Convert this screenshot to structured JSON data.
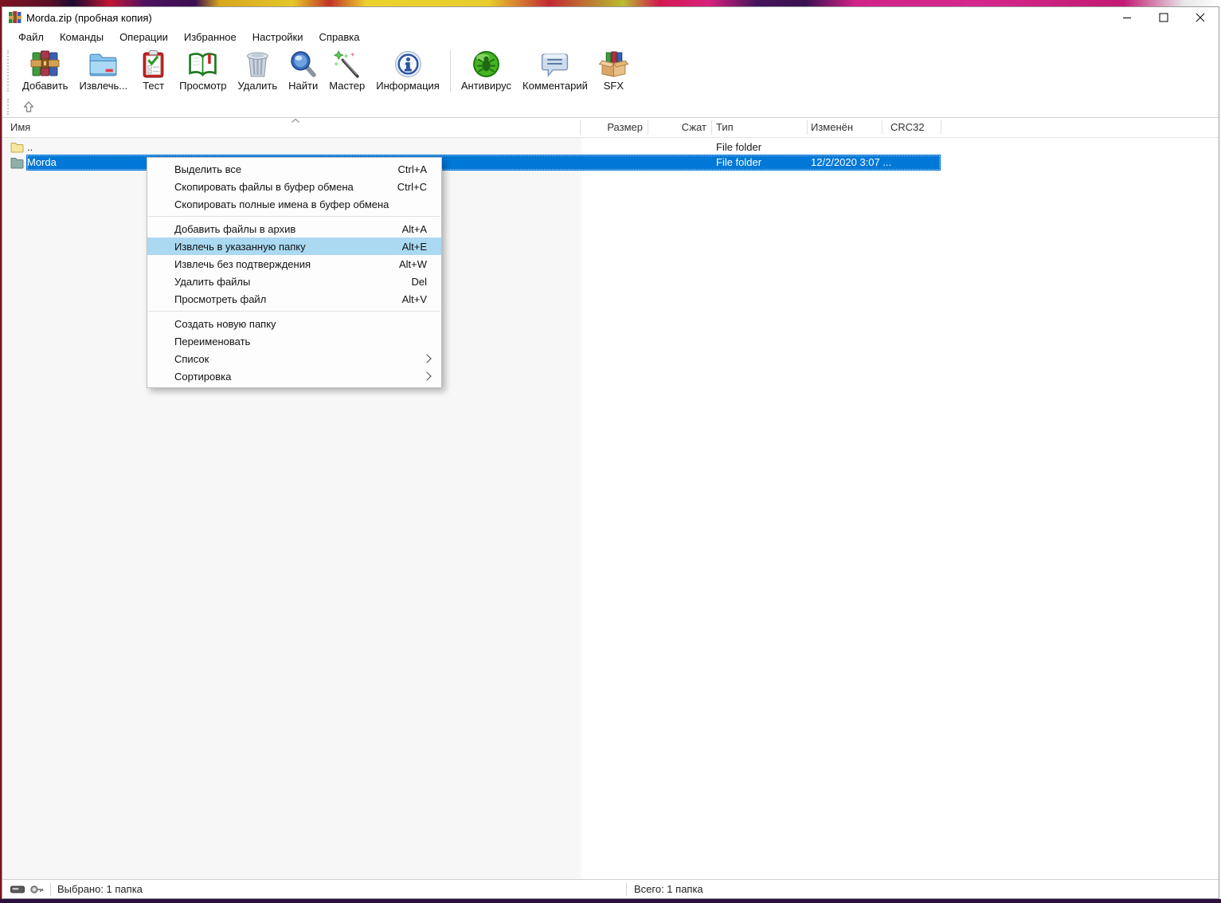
{
  "window": {
    "title": "Morda.zip (пробная копия)"
  },
  "menubar": {
    "items": [
      "Файл",
      "Команды",
      "Операции",
      "Избранное",
      "Настройки",
      "Справка"
    ]
  },
  "toolbar": {
    "buttons": [
      {
        "icon": "add-archive-icon",
        "label": "Добавить"
      },
      {
        "icon": "extract-folder-icon",
        "label": "Извлечь..."
      },
      {
        "icon": "test-clipboard-icon",
        "label": "Тест"
      },
      {
        "icon": "view-book-icon",
        "label": "Просмотр"
      },
      {
        "icon": "delete-trash-icon",
        "label": "Удалить"
      },
      {
        "icon": "find-magnifier-icon",
        "label": "Найти"
      },
      {
        "icon": "wizard-wand-icon",
        "label": "Мастер"
      },
      {
        "icon": "info-icon",
        "label": "Информация"
      },
      {
        "icon": "antivirus-bug-icon",
        "label": "Антивирус"
      },
      {
        "icon": "comment-bubble-icon",
        "label": "Комментарий"
      },
      {
        "icon": "sfx-box-icon",
        "label": "SFX"
      }
    ]
  },
  "columns": {
    "name": "Имя",
    "size": "Размер",
    "packed": "Сжат",
    "type": "Тип",
    "modified": "Изменён",
    "crc": "CRC32"
  },
  "rows": [
    {
      "name": "..",
      "type": "File folder",
      "modified": ""
    },
    {
      "name": "Morda",
      "type": "File folder",
      "modified": "12/2/2020 3:07 ...",
      "selected": true
    }
  ],
  "context_menu": {
    "items": [
      {
        "label": "Выделить все",
        "shortcut": "Ctrl+A"
      },
      {
        "label": "Скопировать файлы в буфер обмена",
        "shortcut": "Ctrl+C"
      },
      {
        "label": "Скопировать полные имена в буфер обмена",
        "shortcut": ""
      },
      {
        "label": "Добавить файлы в архив",
        "shortcut": "Alt+A"
      },
      {
        "label": "Извлечь в указанную папку",
        "shortcut": "Alt+E"
      },
      {
        "label": "Извлечь без подтверждения",
        "shortcut": "Alt+W"
      },
      {
        "label": "Удалить файлы",
        "shortcut": "Del"
      },
      {
        "label": "Просмотреть файл",
        "shortcut": "Alt+V"
      },
      {
        "label": "Создать новую папку",
        "shortcut": ""
      },
      {
        "label": "Переименовать",
        "shortcut": ""
      },
      {
        "label": "Список",
        "shortcut": ""
      },
      {
        "label": "Сортировка",
        "shortcut": ""
      }
    ],
    "highlighted_index": 4
  },
  "statusbar": {
    "selected": "Выбрано: 1 папка",
    "total": "Всего: 1 папка"
  },
  "colors": {
    "selection": "#0078d7",
    "menu_highlight": "#abd9f2"
  }
}
